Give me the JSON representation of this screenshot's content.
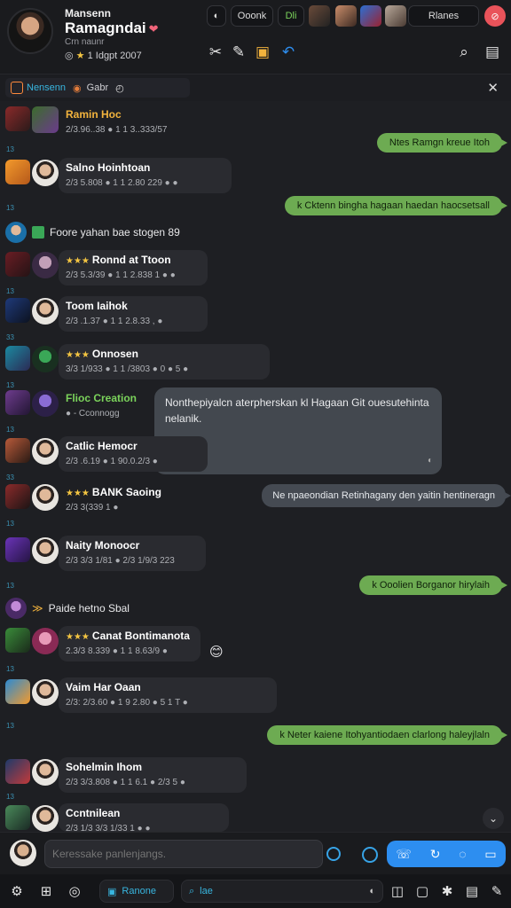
{
  "header": {
    "name_small": "Mansenn",
    "name_big": "Ramagndai",
    "subtitle": "Crn naunr",
    "status": "1 Idgpt 2007",
    "pill_1": "Ooonk",
    "pill_2": "Dli",
    "pill_3": "Rlanes"
  },
  "pinned": {
    "label": "Nensenn",
    "sub": "Gabr"
  },
  "messages": [
    {
      "title": "Ramin Hoc",
      "stats": "2/3.96..38  ● 1 1 3..333/57",
      "num": "13"
    },
    {
      "title": "Salno Hoinhtoan",
      "stats": "2/3 5.808  ● 1 1 2.80 229 ● ●",
      "num": "13"
    },
    {
      "title": "Ronnd at Ttoon",
      "stats": "2/3 5.3/39  ● 1 1 2.838 1 ● ●",
      "num": "13"
    },
    {
      "title": "Toom Iaihok",
      "stats": "2/3 .1.37  ● 1 1 2.8.33 , ●",
      "num": "33"
    },
    {
      "title": "Onnosen",
      "stats": "3/3 1/933  ● 1 1 /3803 ● 0 ● 5 ●",
      "num": "13"
    },
    {
      "title": "Flioc Creation",
      "stats": "● - Cconnogg",
      "num": "13"
    },
    {
      "title": "Catlic Hemocr",
      "stats": "2/3 .6.19  ● 1 90.0.2/3 ●",
      "num": "33"
    },
    {
      "title": "BANK Saoing",
      "stats": "2/3 3(339 1 ●",
      "num": "13"
    },
    {
      "title": "Naity Monoocr",
      "stats": "2/3 3/3 1/81  ● 2/3 1/9/3 223",
      "num": "13"
    },
    {
      "title": "Canat Bontimanota",
      "stats": "2.3/3 8.339  ● 1 1 8.63/9 ●",
      "num": "13"
    },
    {
      "title": "Vaim Har Oaan",
      "stats": "2/3: 2/3.60  ● 1 9 2.80 ● 5 1 T ●",
      "num": "13"
    },
    {
      "title": "Sohelmin Ihom",
      "stats": "2/3 3/3.808  ● 1 1 6.1 ● 2/3 5 ●",
      "num": "13"
    },
    {
      "title": "Ccntnilean",
      "stats": "2/3 1/3 3/3 1/33 1 ● ●",
      "num": ""
    }
  ],
  "outgoing": [
    "Ntes Ramgn kreue Itoh",
    "k Cktenn bingha hagaan haedan haocsetsall",
    "k Ooolien Borganor hirylaih",
    "k Neter kaiene Itohyantiodaen clarlong haleyjlaln"
  ],
  "gray_bubble": "Ne npaeondian Retinhagany den yaitin hentineragn",
  "big_bubble": "Nonthepiyalcn aterpherskan kl Hagaan Git ouesutehinta nelanik.",
  "plain_rows": [
    "Foore yahan bae stogen 89",
    "Paide hetno Sbal"
  ],
  "composer": {
    "placeholder": "Keressake panlenjangs."
  },
  "nav": {
    "tab_1": "Ranone",
    "tab_2": "lae"
  },
  "colors": {
    "out_bubble": "#6dab52",
    "accent_blue": "#2d8ef0",
    "card_bg": "#2a2b30"
  }
}
